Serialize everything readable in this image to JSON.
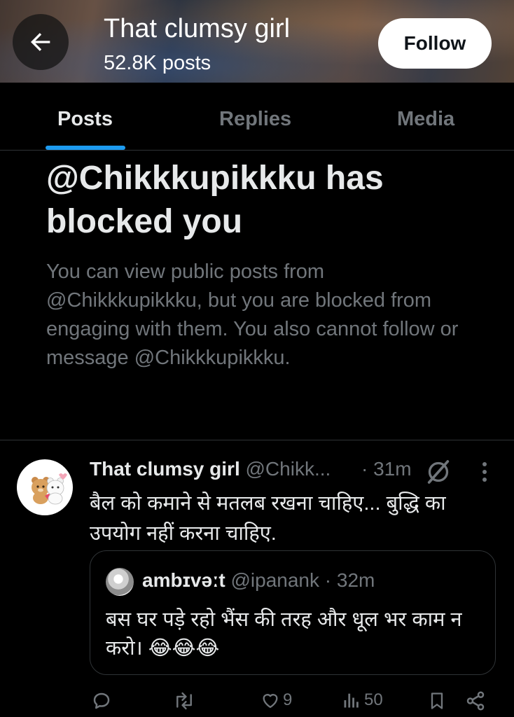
{
  "header": {
    "title": "That clumsy girl",
    "post_count": "52.8K posts",
    "follow_label": "Follow"
  },
  "tabs": [
    {
      "label": "Posts",
      "active": true
    },
    {
      "label": "Replies",
      "active": false
    },
    {
      "label": "Media",
      "active": false
    }
  ],
  "blocked": {
    "title": "@Chikkkupikkku has blocked you",
    "message": "You can view public posts from @Chikkkupikkku, but you are blocked from engaging with them. You also cannot follow or message @Chikkkupikkku."
  },
  "post": {
    "author_name": "That clumsy girl",
    "author_handle": "@Chikk...",
    "time": "· 31m",
    "text": "बैल को कमाने से मतलब रखना चाहिए... बुद्धि का उपयोग नहीं करना चाहिए.",
    "quote": {
      "author_name": "ambɪvəːt",
      "author_handle": "@ipanank",
      "time": "· 32m",
      "text": "बस घर पड़े रहो भैंस की तरह और धूल भर काम न करो। 😂😂😂"
    },
    "actions": {
      "replies": "",
      "reposts": "",
      "likes": "9",
      "views": "50"
    }
  },
  "colors": {
    "background": "#000000",
    "accent": "#1d9bf0",
    "text_primary": "#e7e9ea",
    "text_secondary": "#71767b",
    "border": "#2f3336"
  },
  "icons": [
    "back-arrow-icon",
    "grok-icon",
    "more-icon",
    "reply-icon",
    "repost-icon",
    "like-icon",
    "views-icon",
    "bookmark-icon",
    "share-icon"
  ]
}
